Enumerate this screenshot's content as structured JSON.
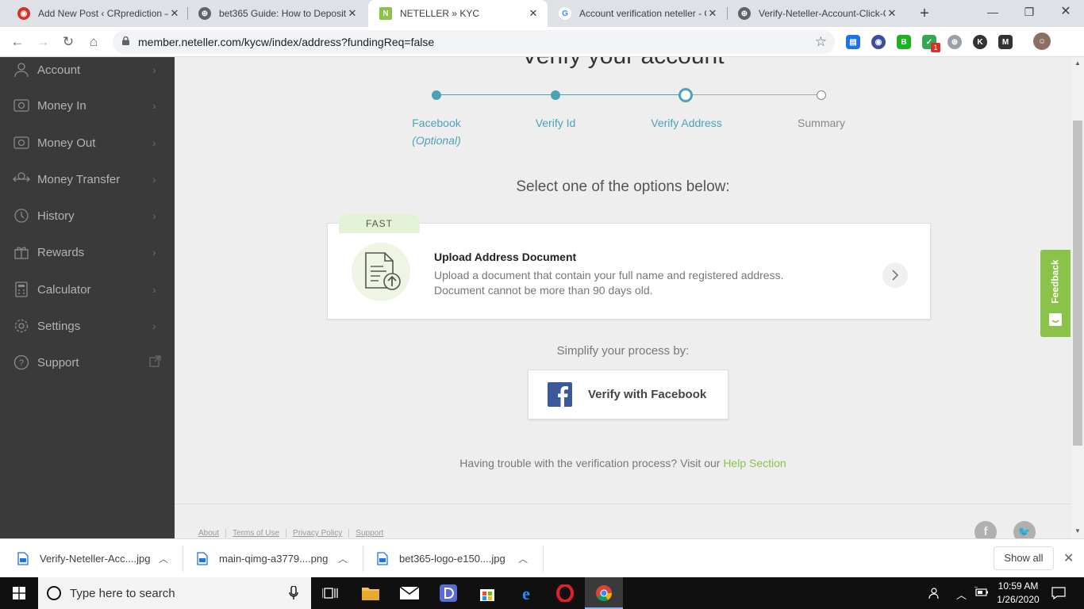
{
  "browser": {
    "tabs": [
      {
        "title": "Add New Post ‹ CRprediction –",
        "fav_color": "#d93025",
        "fav_glyph": "◉"
      },
      {
        "title": "bet365 Guide: How to Deposit",
        "fav_color": "#5f6368",
        "fav_glyph": "⊕"
      },
      {
        "title": "NETELLER » KYC",
        "fav_color": "#8bc34a",
        "fav_glyph": "N"
      },
      {
        "title": "Account verification neteller - G",
        "fav_color": "#4285f4",
        "fav_glyph": "G"
      },
      {
        "title": "Verify-Neteller-Account-Click-C",
        "fav_color": "#5f6368",
        "fav_glyph": "⊕"
      }
    ],
    "active_tab": 2,
    "url": "member.neteller.com/kycw/index/address?fundingReq=false",
    "extension_badge": "1"
  },
  "sidebar": {
    "items": [
      {
        "label": "Account",
        "icon": "user-icon"
      },
      {
        "label": "Money In",
        "icon": "money-in-icon"
      },
      {
        "label": "Money Out",
        "icon": "money-out-icon"
      },
      {
        "label": "Money Transfer",
        "icon": "transfer-icon"
      },
      {
        "label": "History",
        "icon": "history-icon"
      },
      {
        "label": "Rewards",
        "icon": "rewards-icon"
      },
      {
        "label": "Calculator",
        "icon": "calculator-icon"
      },
      {
        "label": "Settings",
        "icon": "gear-icon"
      },
      {
        "label": "Support",
        "icon": "help-icon"
      }
    ]
  },
  "main": {
    "title": "Verify your account",
    "steps": [
      {
        "label": "Facebook",
        "sub": "(Optional)",
        "state": "done"
      },
      {
        "label": "Verify Id",
        "sub": "",
        "state": "done"
      },
      {
        "label": "Verify Address",
        "sub": "",
        "state": "current"
      },
      {
        "label": "Summary",
        "sub": "",
        "state": "pending"
      }
    ],
    "select_title": "Select one of the options below:",
    "option": {
      "badge": "FAST",
      "title": "Upload Address Document",
      "desc_line1": "Upload a document that contain your full name and registered address.",
      "desc_line2": "Document cannot be more than 90 days old."
    },
    "simplify": "Simplify your process by:",
    "facebook_button": "Verify with Facebook",
    "trouble_text": "Having trouble with the verification process? Visit our ",
    "help_link": "Help Section",
    "footer_links": [
      "About",
      "Terms of Use",
      "Privacy Policy",
      "Support"
    ],
    "feedback": "Feedback"
  },
  "downloads": {
    "items": [
      "Verify-Neteller-Acc....jpg",
      "main-qimg-a3779....png",
      "bet365-logo-e150....jpg"
    ],
    "show_all": "Show all"
  },
  "taskbar": {
    "search_placeholder": "Type here to search",
    "time": "10:59 AM",
    "date": "1/26/2020"
  },
  "colors": {
    "accent": "#4aa3b5",
    "green": "#8bc34a",
    "sidebar_bg": "#3a3a3a",
    "facebook": "#3b5998"
  }
}
